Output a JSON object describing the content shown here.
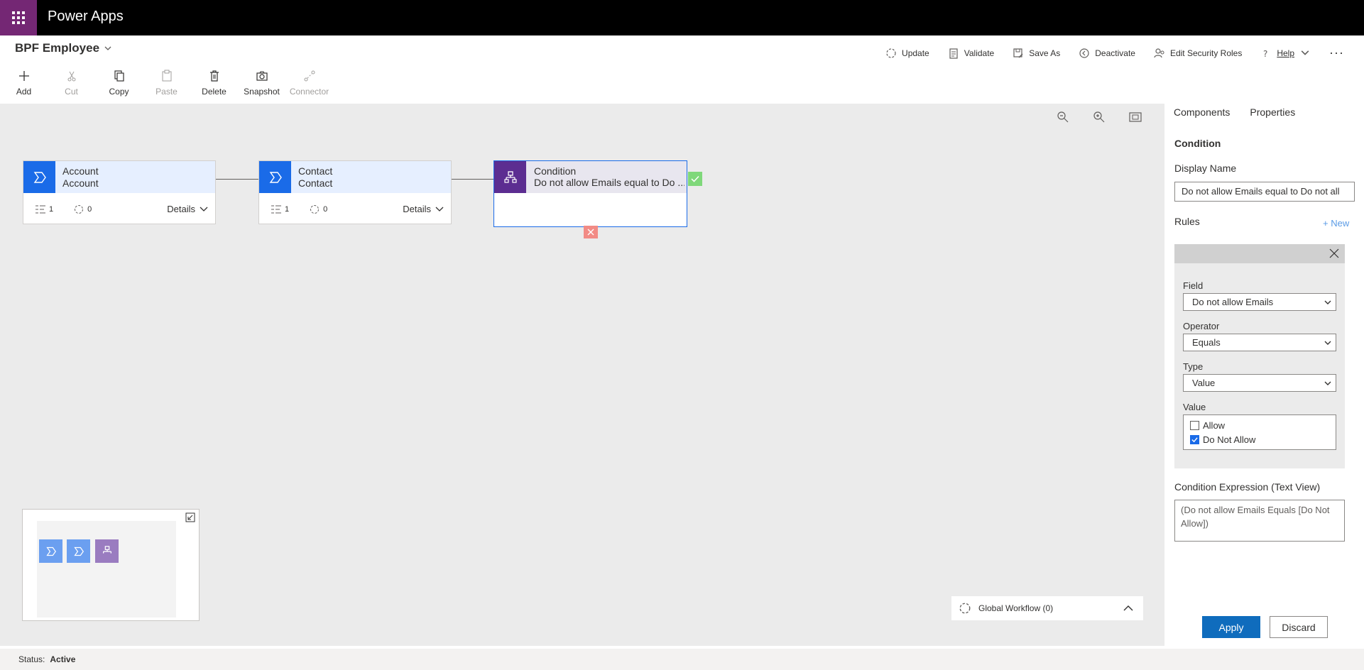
{
  "app": {
    "title": "Power Apps"
  },
  "process": {
    "name": "BPF Employee"
  },
  "commands": [
    {
      "label": "Update",
      "icon": "refresh-icon"
    },
    {
      "label": "Validate",
      "icon": "clipboard-icon"
    },
    {
      "label": "Save As",
      "icon": "save-as-icon"
    },
    {
      "label": "Deactivate",
      "icon": "deactivate-icon"
    },
    {
      "label": "Edit Security Roles",
      "icon": "people-icon"
    },
    {
      "label": "Help",
      "icon": "help-icon"
    }
  ],
  "tools": [
    {
      "label": "Add",
      "icon": "plus-icon",
      "enabled": true
    },
    {
      "label": "Cut",
      "icon": "scissors-icon",
      "enabled": false
    },
    {
      "label": "Copy",
      "icon": "copy-icon",
      "enabled": true
    },
    {
      "label": "Paste",
      "icon": "paste-icon",
      "enabled": false
    },
    {
      "label": "Delete",
      "icon": "trash-icon",
      "enabled": true
    },
    {
      "label": "Snapshot",
      "icon": "camera-icon",
      "enabled": true
    },
    {
      "label": "Connector",
      "icon": "connector-icon",
      "enabled": false
    }
  ],
  "stages": [
    {
      "title": "Account",
      "entity": "Account",
      "steps": "1",
      "workflows": "0",
      "details": "Details"
    },
    {
      "title": "Contact",
      "entity": "Contact",
      "steps": "1",
      "workflows": "0",
      "details": "Details"
    }
  ],
  "condition": {
    "title": "Condition",
    "subtitle": "Do not allow Emails equal to Do ..."
  },
  "global_workflow": {
    "label": "Global Workflow (0)"
  },
  "panel": {
    "tabs": [
      "Components",
      "Properties"
    ],
    "active_tab": "Properties",
    "section": "Condition",
    "display_name_label": "Display Name",
    "display_name_value": "Do not allow Emails equal to Do not all",
    "rules_label": "Rules",
    "new_link": "+ New",
    "field_label": "Field",
    "field_value": "Do not allow Emails",
    "operator_label": "Operator",
    "operator_value": "Equals",
    "type_label": "Type",
    "type_value": "Value",
    "value_label": "Value",
    "options": [
      {
        "label": "Allow",
        "checked": false
      },
      {
        "label": "Do Not Allow",
        "checked": true
      }
    ],
    "expression_label": "Condition Expression (Text View)",
    "expression_value": "(Do not allow Emails Equals [Do Not Allow])",
    "apply": "Apply",
    "discard": "Discard"
  },
  "status": {
    "label": "Status:",
    "value": "Active"
  },
  "colors": {
    "brand": "#742774",
    "accent": "#1a6be8",
    "condition": "#5c2d91",
    "apply": "#0f6cbd"
  }
}
